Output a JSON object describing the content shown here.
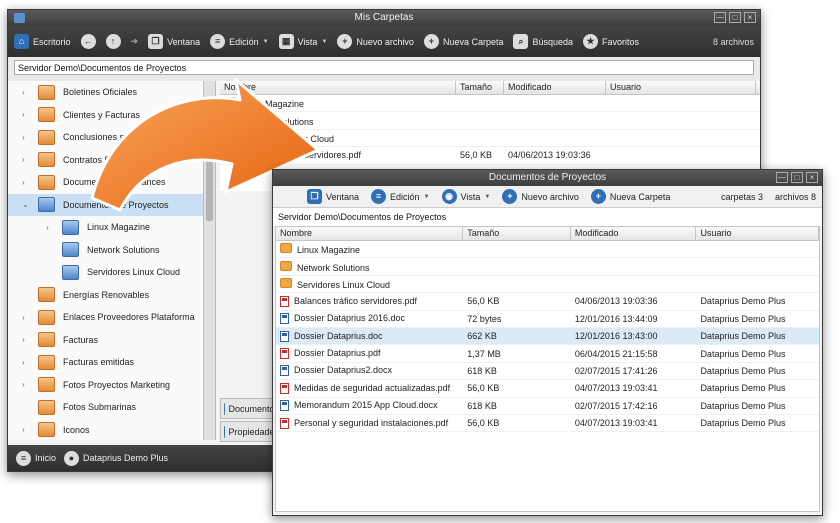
{
  "back_window": {
    "title": "Mis Carpetas",
    "toolbar": {
      "escritorio": "Escritorio",
      "ventana": "Ventana",
      "edicion": "Edición",
      "vista": "Vista",
      "nuevo_archivo": "Nuevo archivo",
      "nueva_carpeta": "Nueva Carpeta",
      "busqueda": "Búsqueda",
      "favoritos": "Favoritos",
      "count": "8 archivos"
    },
    "path": "Servidor Demo\\Documentos de Proyectos",
    "tree": [
      {
        "label": "Boletines Oficiales",
        "color": "or",
        "level": 0,
        "exp": "›"
      },
      {
        "label": "Clientes y Facturas",
        "color": "or",
        "level": 0,
        "exp": "›"
      },
      {
        "label": "Conclusiones seminario",
        "color": "or",
        "level": 0,
        "exp": "›"
      },
      {
        "label": "Contratos Firmados 2016",
        "color": "or",
        "level": 0,
        "exp": "›"
      },
      {
        "label": "Documentos de Balances",
        "color": "or",
        "level": 0,
        "exp": "›"
      },
      {
        "label": "Documentos de Proyectos",
        "color": "bl",
        "level": 0,
        "exp": "⌄",
        "selected": true
      },
      {
        "label": "Linux Magazine",
        "color": "bl",
        "level": 1,
        "exp": "›"
      },
      {
        "label": "Network Solutions",
        "color": "bl",
        "level": 1,
        "exp": ""
      },
      {
        "label": "Servidores Linux Cloud",
        "color": "bl",
        "level": 1,
        "exp": ""
      },
      {
        "label": "Energías Renovables",
        "color": "or",
        "level": 0,
        "exp": ""
      },
      {
        "label": "Enlaces Proveedores Plataforma",
        "color": "or",
        "level": 0,
        "exp": "›"
      },
      {
        "label": "Facturas",
        "color": "or",
        "level": 0,
        "exp": "›"
      },
      {
        "label": "Facturas emitidas",
        "color": "or",
        "level": 0,
        "exp": "›"
      },
      {
        "label": "Fotos Proyectos Marketing",
        "color": "or",
        "level": 0,
        "exp": "›"
      },
      {
        "label": "Fotos Submarinas",
        "color": "or",
        "level": 0,
        "exp": ""
      },
      {
        "label": "Iconos",
        "color": "or",
        "level": 0,
        "exp": "›"
      }
    ],
    "columns": [
      "Nombre",
      "Tamaño",
      "Modificado",
      "Usuario"
    ],
    "files": [
      {
        "name": "Linux Magazine",
        "type": "folder",
        "size": "",
        "modified": ""
      },
      {
        "name": "Network Solutions",
        "type": "folder",
        "size": "",
        "modified": ""
      },
      {
        "name": "Servidores Linux Cloud",
        "type": "folder",
        "size": "",
        "modified": ""
      },
      {
        "name": "Balances tráfico servidores.pdf",
        "type": "pdf",
        "size": "56,0 KB",
        "modified": "04/06/2013 19:03:36"
      }
    ],
    "side_panels": [
      {
        "label": "Documentos"
      },
      {
        "label": "Propiedades"
      }
    ],
    "status": {
      "inicio": "Inicio",
      "user": "Dataprius Demo Plus"
    }
  },
  "front_window": {
    "title": "Documentos de Proyectos",
    "toolbar": {
      "ventana": "Ventana",
      "edicion": "Edición",
      "vista": "Vista",
      "nuevo_archivo": "Nuevo archivo",
      "nueva_carpeta": "Nueva Carpeta",
      "carpetas": "carpetas 3",
      "archivos": "archivos 8"
    },
    "path": "Servidor Demo\\Documentos de Proyectos",
    "columns": [
      "Nombre",
      "Tamaño",
      "Modificado",
      "Usuario"
    ],
    "files": [
      {
        "name": "Linux Magazine",
        "type": "folder",
        "size": "",
        "modified": "",
        "user": ""
      },
      {
        "name": "Network Solutions",
        "type": "folder",
        "size": "",
        "modified": "",
        "user": ""
      },
      {
        "name": "Servidores Linux Cloud",
        "type": "folder",
        "size": "",
        "modified": "",
        "user": ""
      },
      {
        "name": "Balances tráfico servidores.pdf",
        "type": "pdf",
        "size": "56,0 KB",
        "modified": "04/06/2013 19:03:36",
        "user": "Dataprius Demo Plus"
      },
      {
        "name": "Dossier Dataprius 2016.doc",
        "type": "doc",
        "size": "72 bytes",
        "modified": "12/01/2016 13:44:09",
        "user": "Dataprius Demo Plus"
      },
      {
        "name": "Dossier Dataprius.doc",
        "type": "doc",
        "size": "662 KB",
        "modified": "12/01/2016 13:43:00",
        "user": "Dataprius Demo Plus",
        "selected": true
      },
      {
        "name": "Dossier Dataprius.pdf",
        "type": "pdf",
        "size": "1,37 MB",
        "modified": "06/04/2015 21:15:58",
        "user": "Dataprius Demo Plus"
      },
      {
        "name": "Dossier Dataprius2.docx",
        "type": "doc",
        "size": "618 KB",
        "modified": "02/07/2015 17:41:26",
        "user": "Dataprius Demo Plus"
      },
      {
        "name": "Medidas de seguridad actualizadas.pdf",
        "type": "pdf",
        "size": "56,0 KB",
        "modified": "04/07/2013 19:03:41",
        "user": "Dataprius Demo Plus"
      },
      {
        "name": "Memorandum 2015 App Cloud.docx",
        "type": "doc",
        "size": "618 KB",
        "modified": "02/07/2015 17:42:16",
        "user": "Dataprius Demo Plus"
      },
      {
        "name": "Personal y seguridad instalaciones.pdf",
        "type": "pdf",
        "size": "56,0 KB",
        "modified": "04/07/2013 19:03:41",
        "user": "Dataprius Demo Plus"
      }
    ]
  },
  "colors": {
    "accent": "#2f6fb6",
    "arrow": "#f07a1e",
    "toolbar": "#3a3a3a",
    "selection": "#c9dff4"
  }
}
